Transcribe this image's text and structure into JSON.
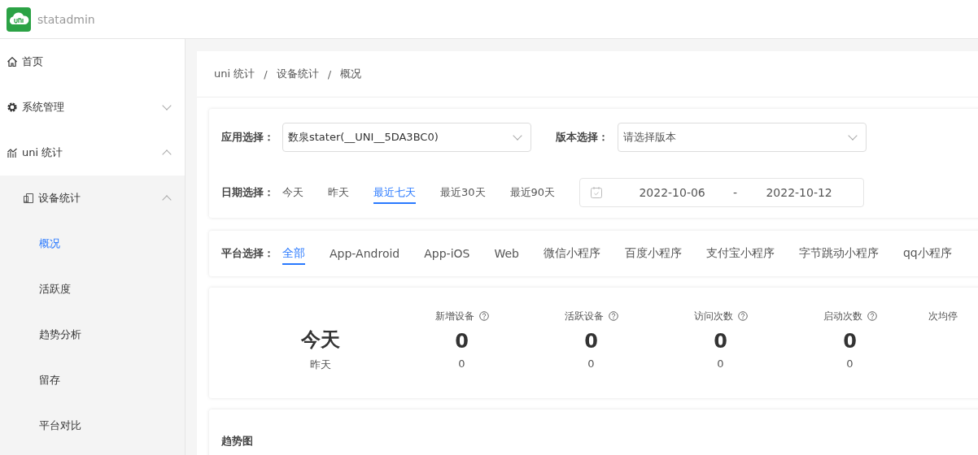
{
  "header": {
    "app_name": "statadmin"
  },
  "sidebar": {
    "items": [
      {
        "label": "首页",
        "kind": "home",
        "selected": false
      },
      {
        "label": "系统管理",
        "kind": "settings",
        "expanded": false,
        "selected": false
      },
      {
        "label": "uni 统计",
        "kind": "stats",
        "expanded": true,
        "selected": false,
        "children": [
          {
            "label": "设备统计",
            "kind": "devices",
            "expanded": true,
            "selected": false,
            "children": [
              {
                "label": "概况",
                "selected": true
              },
              {
                "label": "活跃度",
                "selected": false
              },
              {
                "label": "趋势分析",
                "selected": false
              },
              {
                "label": "留存",
                "selected": false
              },
              {
                "label": "平台对比",
                "selected": false
              }
            ]
          }
        ]
      }
    ]
  },
  "breadcrumb": [
    "uni 统计",
    "设备统计",
    "概况"
  ],
  "breadcrumb_separator": "/",
  "filters": {
    "app_label": "应用选择：",
    "app_value": "数泉stater(__UNI__5DA3BC0)",
    "version_label": "版本选择：",
    "version_placeholder": "请选择版本",
    "date_label": "日期选择：",
    "date_options": [
      {
        "label": "今天",
        "selected": false
      },
      {
        "label": "昨天",
        "selected": false
      },
      {
        "label": "最近七天",
        "selected": true
      },
      {
        "label": "最近30天",
        "selected": false
      },
      {
        "label": "最近90天",
        "selected": false
      }
    ],
    "date_start": "2022-10-06",
    "date_separator": "-",
    "date_end": "2022-10-12"
  },
  "platforms": {
    "label": "平台选择：",
    "options": [
      {
        "label": "全部",
        "selected": true
      },
      {
        "label": "App-Android",
        "selected": false
      },
      {
        "label": "App-iOS",
        "selected": false
      },
      {
        "label": "Web",
        "selected": false
      },
      {
        "label": "微信小程序",
        "selected": false
      },
      {
        "label": "百度小程序",
        "selected": false
      },
      {
        "label": "支付宝小程序",
        "selected": false
      },
      {
        "label": "字节跳动小程序",
        "selected": false
      },
      {
        "label": "qq小程序",
        "selected": false
      }
    ]
  },
  "stats": {
    "today_label": "今天",
    "yesterday_label": "昨天",
    "metrics": [
      {
        "label": "新增设备",
        "today": "0",
        "yesterday": "0"
      },
      {
        "label": "活跃设备",
        "today": "0",
        "yesterday": "0"
      },
      {
        "label": "访问次数",
        "today": "0",
        "yesterday": "0"
      },
      {
        "label": "启动次数",
        "today": "0",
        "yesterday": "0"
      },
      {
        "label": "次均停"
      }
    ]
  },
  "trend": {
    "title": "趋势图"
  }
}
